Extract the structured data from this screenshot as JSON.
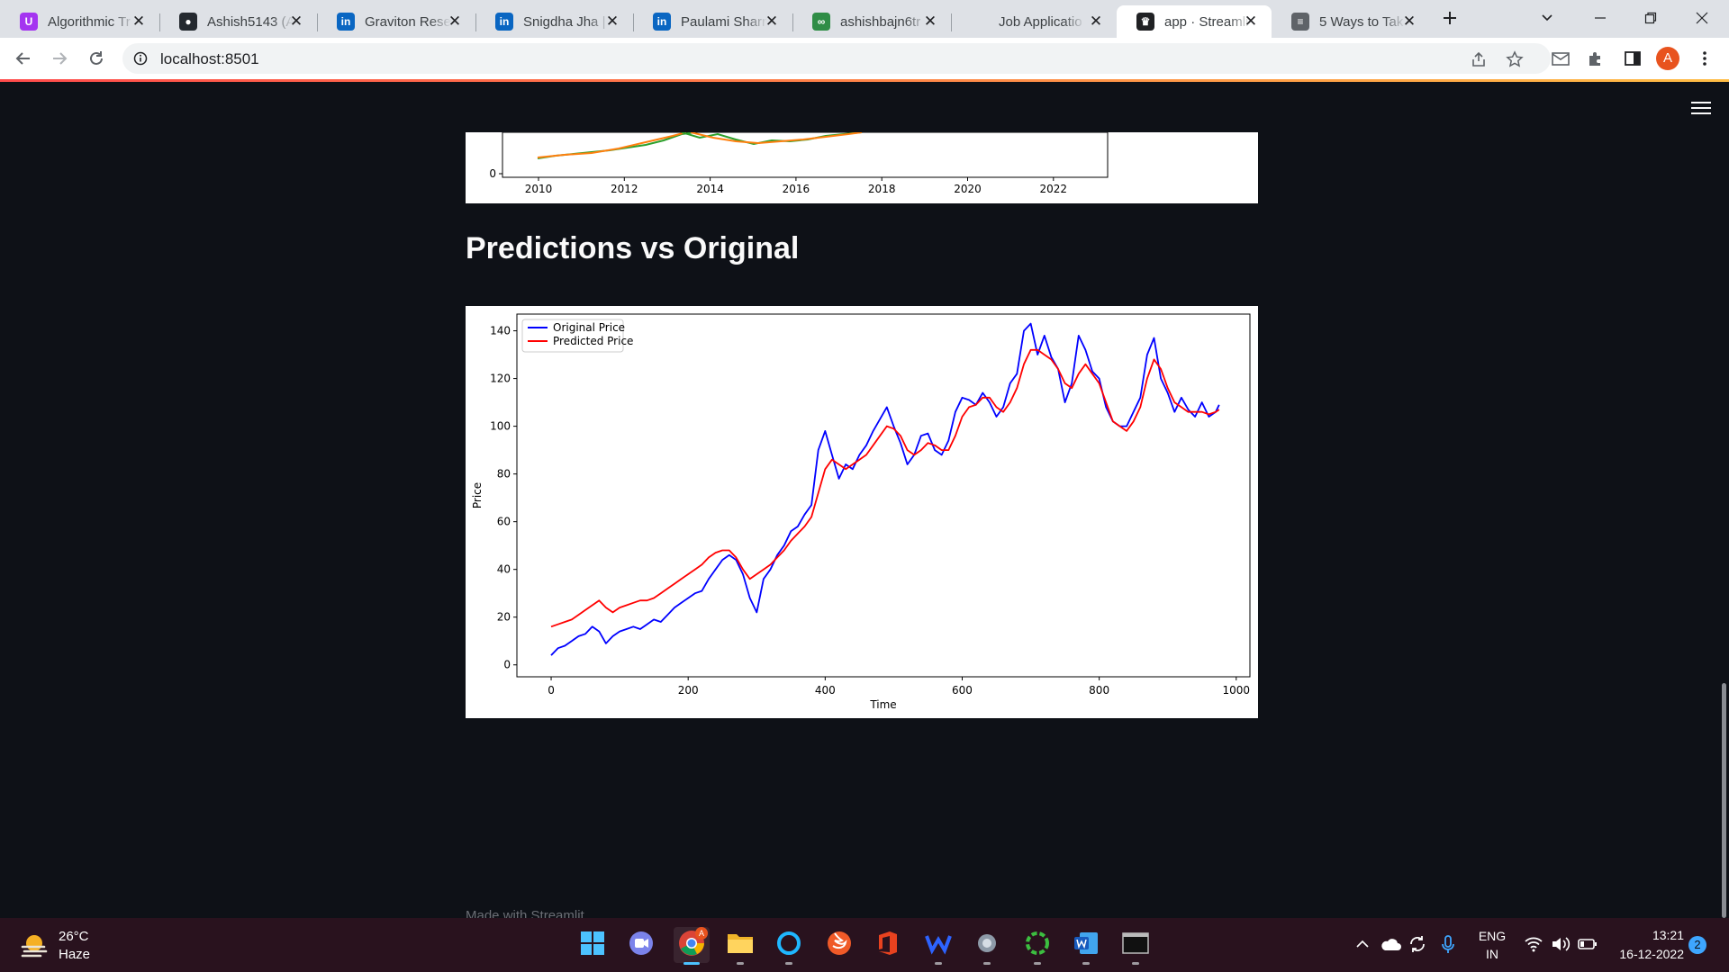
{
  "browser": {
    "tabs": [
      {
        "title": "Algorithmic Tr",
        "favicon": "udemy-icon",
        "color": "#a435f0",
        "active": false
      },
      {
        "title": "Ashish5143 (A",
        "favicon": "github-icon",
        "color": "#24292f",
        "active": false
      },
      {
        "title": "Graviton Rese",
        "favicon": "linkedin-icon",
        "color": "#0a66c2",
        "active": false
      },
      {
        "title": "Snigdha Jha | ",
        "favicon": "linkedin-icon",
        "color": "#0a66c2",
        "active": false
      },
      {
        "title": "Paulami Sharm",
        "favicon": "linkedin-icon",
        "color": "#0a66c2",
        "active": false
      },
      {
        "title": "ashishbajn6tr",
        "favicon": "geeksforgeeks-icon",
        "color": "#2f8d46",
        "active": false
      },
      {
        "title": "Job Applicatio",
        "favicon": "",
        "color": "",
        "active": false
      },
      {
        "title": "app · Streamli",
        "favicon": "streamlit-icon",
        "color": "#202124",
        "active": true
      },
      {
        "title": "5 Ways to Tak",
        "favicon": "article-icon",
        "color": "#5f6368",
        "active": false
      }
    ],
    "url": "localhost:8501",
    "profile_initial": "A",
    "accent": "#ff4b4b"
  },
  "page": {
    "heading": "Predictions vs Original",
    "footer": "Made with Streamlit"
  },
  "chart_data": [
    {
      "type": "line",
      "title": "",
      "xlabel": "",
      "ylabel": "",
      "x_ticks": [
        "2010",
        "2012",
        "2014",
        "2016",
        "2018",
        "2020",
        "2022"
      ],
      "y_ticks_visible": [
        "0"
      ],
      "note": "partially scrolled out of view"
    },
    {
      "type": "line",
      "title": "",
      "xlabel": "Time",
      "ylabel": "Price",
      "xlim": [
        -50,
        1020
      ],
      "ylim": [
        -5,
        147
      ],
      "x_ticks": [
        "0",
        "200",
        "400",
        "600",
        "800",
        "1000"
      ],
      "y_ticks": [
        "0",
        "20",
        "40",
        "60",
        "80",
        "100",
        "120",
        "140"
      ],
      "legend": {
        "position": "top-left",
        "entries": [
          "Original Price",
          "Predicted Price"
        ]
      },
      "x": [
        0,
        10,
        20,
        30,
        40,
        50,
        60,
        70,
        80,
        90,
        100,
        110,
        120,
        130,
        140,
        150,
        160,
        170,
        180,
        190,
        200,
        210,
        220,
        230,
        240,
        250,
        260,
        270,
        280,
        290,
        300,
        310,
        320,
        330,
        340,
        350,
        360,
        370,
        380,
        390,
        400,
        410,
        420,
        430,
        440,
        450,
        460,
        470,
        480,
        490,
        500,
        510,
        520,
        530,
        540,
        550,
        560,
        570,
        580,
        590,
        600,
        610,
        620,
        630,
        640,
        650,
        660,
        670,
        680,
        690,
        700,
        710,
        720,
        730,
        740,
        750,
        760,
        770,
        780,
        790,
        800,
        810,
        820,
        830,
        840,
        850,
        860,
        870,
        880,
        890,
        900,
        910,
        920,
        930,
        940,
        950,
        960,
        970,
        975
      ],
      "series": [
        {
          "name": "Original Price",
          "color": "#0000ff",
          "values": [
            4,
            7,
            8,
            10,
            12,
            13,
            16,
            14,
            9,
            12,
            14,
            15,
            16,
            15,
            17,
            19,
            18,
            21,
            24,
            26,
            28,
            30,
            31,
            36,
            40,
            44,
            46,
            44,
            38,
            28,
            22,
            36,
            40,
            46,
            50,
            56,
            58,
            63,
            67,
            90,
            98,
            88,
            78,
            84,
            82,
            88,
            92,
            98,
            103,
            108,
            100,
            93,
            84,
            88,
            96,
            97,
            90,
            88,
            94,
            106,
            112,
            111,
            109,
            114,
            110,
            104,
            108,
            118,
            122,
            140,
            143,
            130,
            138,
            129,
            124,
            110,
            118,
            138,
            132,
            123,
            120,
            108,
            102,
            100,
            100,
            106,
            112,
            130,
            137,
            120,
            114,
            106,
            112,
            107,
            104,
            110,
            104,
            106,
            109
          ]
        },
        {
          "name": "Predicted Price",
          "color": "#ff0000",
          "values": [
            16,
            17,
            18,
            19,
            21,
            23,
            25,
            27,
            24,
            22,
            24,
            25,
            26,
            27,
            27,
            28,
            30,
            32,
            34,
            36,
            38,
            40,
            42,
            45,
            47,
            48,
            48,
            45,
            40,
            36,
            38,
            40,
            42,
            45,
            48,
            52,
            55,
            58,
            62,
            72,
            82,
            86,
            84,
            82,
            84,
            86,
            88,
            92,
            96,
            100,
            99,
            96,
            90,
            88,
            90,
            93,
            92,
            90,
            90,
            96,
            104,
            108,
            109,
            112,
            112,
            108,
            106,
            110,
            116,
            126,
            132,
            132,
            130,
            128,
            124,
            118,
            116,
            122,
            126,
            122,
            118,
            110,
            102,
            100,
            98,
            102,
            108,
            120,
            128,
            124,
            116,
            110,
            108,
            106,
            106,
            106,
            105,
            106,
            107
          ]
        }
      ]
    }
  ],
  "taskbar": {
    "weather": {
      "temp": "26°C",
      "condition": "Haze"
    },
    "apps": [
      "windows-start-icon",
      "zoom-icon",
      "chrome-icon",
      "file-explorer-icon",
      "cortana-icon",
      "swift-icon",
      "office-icon",
      "webex-icon",
      "settings-icon",
      "refresh-app-icon",
      "word-icon",
      "terminal-icon"
    ],
    "tray": {
      "lang_line1": "ENG",
      "lang_line2": "IN",
      "time": "13:21",
      "date": "16-12-2022",
      "notifications": "2"
    }
  }
}
